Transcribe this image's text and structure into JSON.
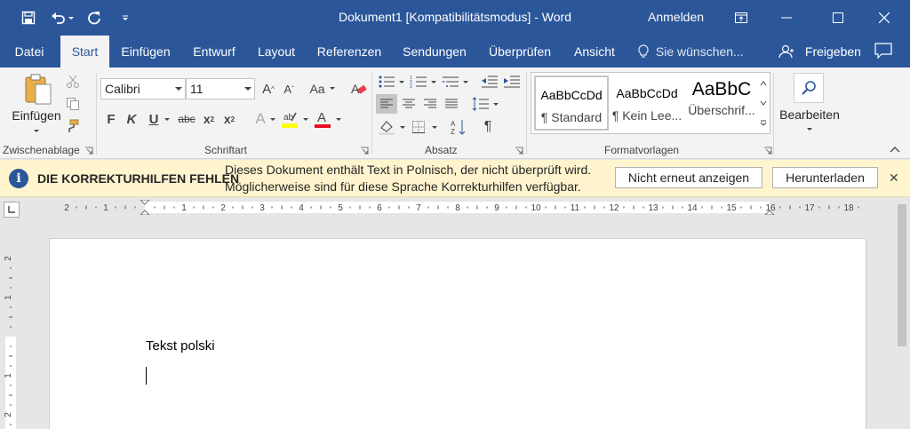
{
  "titlebar": {
    "title": "Dokument1 [Kompatibilitätsmodus]  -  Word",
    "signin": "Anmelden",
    "qat_icons": [
      "save-icon",
      "undo-icon",
      "redo-icon",
      "customize-qat-icon"
    ],
    "window_icons": [
      "ribbon-display-options-icon",
      "minimize-icon",
      "maximize-icon",
      "close-icon"
    ]
  },
  "tabs": [
    {
      "label": "Datei"
    },
    {
      "label": "Start"
    },
    {
      "label": "Einfügen"
    },
    {
      "label": "Entwurf"
    },
    {
      "label": "Layout"
    },
    {
      "label": "Referenzen"
    },
    {
      "label": "Sendungen"
    },
    {
      "label": "Überprüfen"
    },
    {
      "label": "Ansicht"
    }
  ],
  "active_tab": "Start",
  "tell_me": "Sie wünschen...",
  "share": "Freigeben",
  "ribbon": {
    "clipboard": {
      "label": "Zwischenablage",
      "paste_label": "Einfügen"
    },
    "font": {
      "label": "Schriftart",
      "font_name": "Calibri",
      "font_size": "11",
      "case_label": "Aa"
    },
    "paragraph": {
      "label": "Absatz"
    },
    "styles": {
      "label": "Formatvorlagen",
      "items": [
        {
          "sample": "AaBbCcDd",
          "name": "¶ Standard"
        },
        {
          "sample": "AaBbCcDd",
          "name": "¶ Kein Lee..."
        },
        {
          "sample": "AaBbC",
          "name": "Überschrif..."
        }
      ]
    },
    "editing": {
      "label": "Bearbeiten"
    }
  },
  "message_bar": {
    "title": "DIE KORREKTURHILFEN FEHLEN",
    "line1": "Dieses Dokument enthält Text in Polnisch, der nicht überprüft wird.",
    "line2": "Möglicherweise sind für diese Sprache Korrekturhilfen verfügbar.",
    "button_dismiss": "Nicht erneut anzeigen",
    "button_download": "Herunterladen"
  },
  "ruler": {
    "marks": [
      "2",
      "1",
      "",
      "1",
      "2",
      "3",
      "4",
      "5",
      "6",
      "7",
      "8",
      "9",
      "10",
      "11",
      "12",
      "13",
      "14",
      "15",
      "16",
      "17",
      "18"
    ],
    "vertical_marks": [
      "2",
      "1",
      "",
      "1",
      "2"
    ]
  },
  "document": {
    "text": "Tekst polski"
  },
  "colors": {
    "brand": "#2b579a",
    "highlight": "#ffff00",
    "font_color": "#e81123",
    "message_bar": "#fff4ce"
  }
}
